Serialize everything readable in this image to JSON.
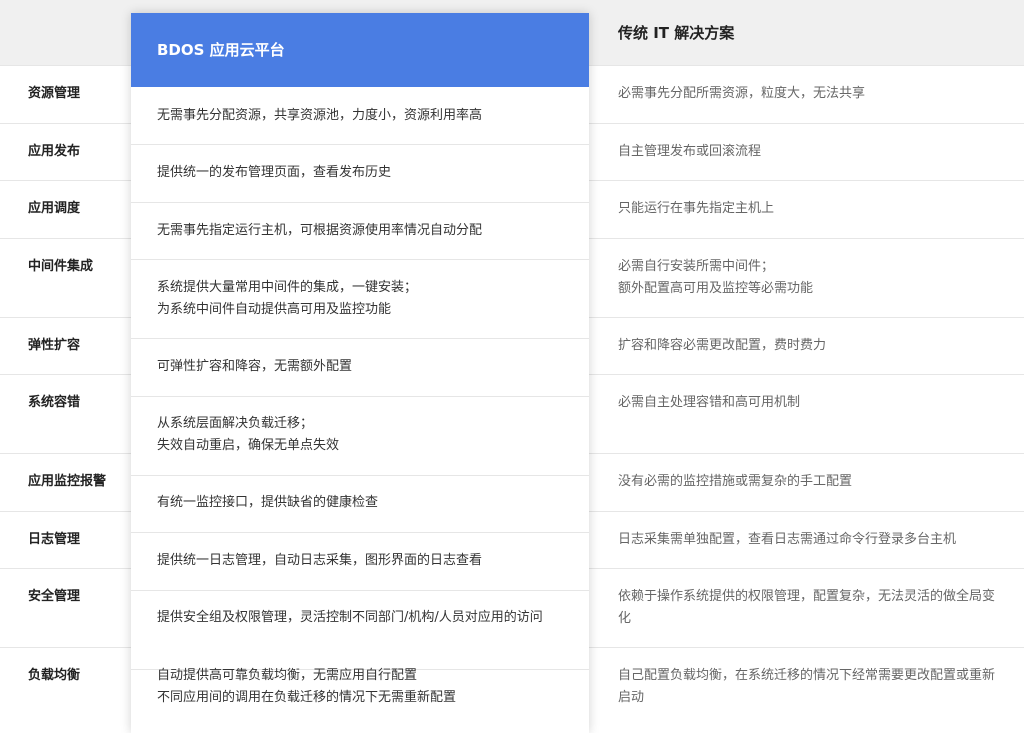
{
  "header": {
    "bdos_title": "BDOS 应用云平台",
    "traditional_title": "传统 IT 解决方案"
  },
  "rows": [
    {
      "label": "资源管理",
      "bdos": [
        "无需事先分配资源，共享资源池，力度小，资源利用率高"
      ],
      "traditional": [
        "必需事先分配所需资源，粒度大，无法共享"
      ]
    },
    {
      "label": "应用发布",
      "bdos": [
        "提供统一的发布管理页面，查看发布历史"
      ],
      "traditional": [
        "自主管理发布或回滚流程"
      ]
    },
    {
      "label": "应用调度",
      "bdos": [
        "无需事先指定运行主机，可根据资源使用率情况自动分配"
      ],
      "traditional": [
        "只能运行在事先指定主机上"
      ]
    },
    {
      "label": "中间件集成",
      "bdos": [
        "系统提供大量常用中间件的集成，一键安装；",
        "为系统中间件自动提供高可用及监控功能"
      ],
      "traditional": [
        "必需自行安装所需中间件；",
        "额外配置高可用及监控等必需功能"
      ]
    },
    {
      "label": "弹性扩容",
      "bdos": [
        "可弹性扩容和降容，无需额外配置"
      ],
      "traditional": [
        "扩容和降容必需更改配置，费时费力"
      ]
    },
    {
      "label": "系统容错",
      "bdos": [
        "从系统层面解决负载迁移；",
        "失效自动重启，确保无单点失效"
      ],
      "traditional": [
        "必需自主处理容错和高可用机制"
      ]
    },
    {
      "label": "应用监控报警",
      "bdos": [
        "有统一监控接口，提供缺省的健康检查"
      ],
      "traditional": [
        "没有必需的监控措施或需复杂的手工配置"
      ]
    },
    {
      "label": "日志管理",
      "bdos": [
        "提供统一日志管理，自动日志采集，图形界面的日志查看"
      ],
      "traditional": [
        "日志采集需单独配置，查看日志需通过命令行登录多台主机"
      ]
    },
    {
      "label": "安全管理",
      "bdos": [
        "提供安全组及权限管理，灵活控制不同部门/机构/人员对应用的访问"
      ],
      "traditional": [
        "依赖于操作系统提供的权限管理，配置复杂，无法灵活的做全局变",
        "化"
      ]
    },
    {
      "label": "负载均衡",
      "bdos": [
        "自动提供高可靠负载均衡，无需应用自行配置",
        "不同应用间的调用在负载迁移的情况下无需重新配置"
      ],
      "traditional": [
        "自己配置负载均衡，在系统迁移的情况下经常需要更改配置或重新",
        "启动"
      ]
    }
  ]
}
